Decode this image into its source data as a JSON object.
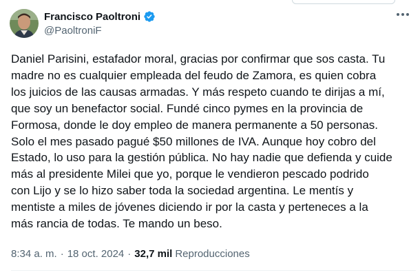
{
  "tweet": {
    "author": {
      "display_name": "Francisco Paoltroni",
      "handle": "@PaoltroniF",
      "verified": true
    },
    "text": "Daniel Parisini, estafador moral, gracias por confirmar que sos casta. Tu\nmadre no es cualquier empleada del feudo de Zamora, es quien cobra\nlos juicios de las causas armadas. Y más respeto cuando te dirijas a mí,\nque soy un benefactor social. Fundé cinco pymes en la provincia de\nFormosa, donde le doy empleo de manera permanente a 50 personas.\nSolo el mes pasado pagué $50 millones de IVA. Aunque hoy cobro del\nEstado, lo uso para la gestión pública. No hay nadie que defienda y cuide\nmás al presidente Milei que yo, porque le vendieron pescado podrido\ncon Lijo y se lo hizo saber toda la sociedad argentina. Le mentís y\nmentiste a miles de jóvenes diciendo ir por la casta y perteneces a la\nmás rancia de todas. Te mando un beso.",
    "time": "8:34 a. m.",
    "date": "18 oct. 2024",
    "separator": "·",
    "views_count": "32,7 mil",
    "views_label": "Reproducciones"
  },
  "icons": {
    "verified": "verified-badge-icon",
    "more": "more-options-icon"
  },
  "colors": {
    "verified_blue": "#1d9bf0",
    "text_primary": "#0f1419",
    "text_secondary": "#536471"
  }
}
